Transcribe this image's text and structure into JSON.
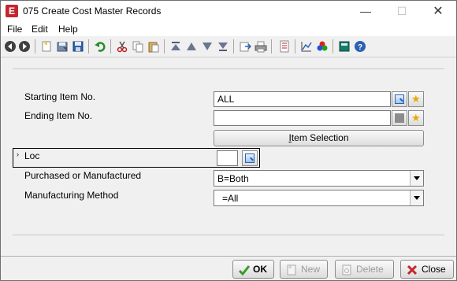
{
  "window": {
    "title": "075 Create Cost Master Records",
    "app_icon_letter": "E",
    "minimize_glyph": "—",
    "maximize_glyph": "☐",
    "close_glyph": "✕"
  },
  "menu": {
    "items": [
      "File",
      "Edit",
      "Help"
    ]
  },
  "toolbar": {
    "icons": [
      "back-icon",
      "forward-icon",
      "new-record-icon",
      "save-as-icon",
      "save-icon",
      "undo-icon",
      "cut-icon",
      "copy-icon",
      "paste-icon",
      "first-record-icon",
      "previous-record-icon",
      "next-record-icon",
      "last-record-icon",
      "export-icon",
      "print-icon",
      "notes-icon",
      "chart-icon",
      "colors-icon",
      "calculator-icon",
      "help-icon"
    ]
  },
  "form": {
    "starting_item": {
      "label": "Starting Item No.",
      "value": "ALL"
    },
    "ending_item": {
      "label": "Ending Item No.",
      "value": ""
    },
    "item_selection_button": {
      "accel": "I",
      "rest": "tem Selection"
    },
    "loc": {
      "label": "Loc",
      "value": ""
    },
    "purchased_or_manufactured": {
      "label": "Purchased or Manufactured",
      "value": "B=Both"
    },
    "manufacturing_method": {
      "label": "Manufacturing Method",
      "value": "=All"
    },
    "row_pointer": "›"
  },
  "buttons": {
    "ok": {
      "label": "OK",
      "enabled": true
    },
    "new": {
      "label": "New",
      "enabled": false
    },
    "delete": {
      "label": "Delete",
      "enabled": false
    },
    "close": {
      "label": "Close",
      "enabled": true
    }
  },
  "colors": {
    "window_bg": "#f0f0f0",
    "title_bg": "#ffffff",
    "app_icon": "#c4262e",
    "ok_check": "#3a9a2a",
    "close_x": "#c4262e"
  }
}
